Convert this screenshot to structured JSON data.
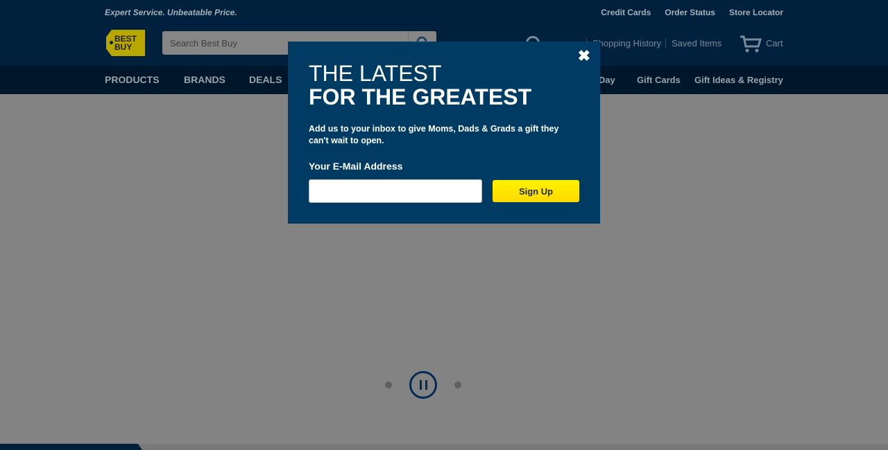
{
  "header": {
    "tagline": "Expert Service. Unbeatable Price.",
    "utility_links": [
      "Credit Cards",
      "Order Status",
      "Store Locator"
    ],
    "logo_text": "BEST BUY",
    "search": {
      "placeholder": "Search Best Buy",
      "icon": "search-icon"
    },
    "account": {
      "icon": "account-icon"
    },
    "shopping_history": "Shopping History",
    "saved_items": "Saved Items",
    "cart": {
      "label": "Cart",
      "icon": "cart-icon"
    }
  },
  "nav": {
    "left": [
      "PRODUCTS",
      "BRANDS",
      "DEALS"
    ],
    "right": [
      "e Day",
      "Gift Cards",
      "Gift Ideas & Registry"
    ]
  },
  "modal": {
    "title_line1": "THE LATEST",
    "title_line2": "FOR THE GREATEST",
    "description": "Add us to your inbox to give Moms, Dads & Grads a gift they can't wait to open.",
    "email_label": "Your E-Mail Address",
    "email_value": "",
    "signup_label": "Sign Up",
    "close_icon": "close-icon"
  },
  "colors": {
    "header_bg": "#00213e",
    "modal_bg": "#003b64",
    "signup_yellow": "#ffe800",
    "overlay_gray": "#838383"
  }
}
